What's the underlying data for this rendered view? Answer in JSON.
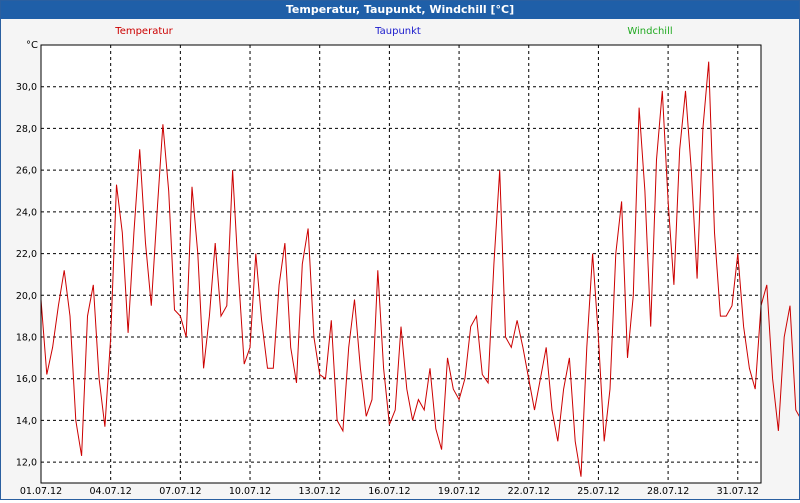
{
  "window": {
    "title": "Temperatur, Taupunkt, Windchill [°C]"
  },
  "colors": {
    "temperatur": "#cc0000",
    "taupunkt": "#1a1acc",
    "windchill": "#22aa22",
    "titlebar": "#1f5fa8",
    "grid": "#000000"
  },
  "chart_data": {
    "type": "line",
    "title": "Temperatur, Taupunkt, Windchill [°C]",
    "ylabel": "°C",
    "ylim": [
      11,
      32
    ],
    "yticks": [
      "12,0",
      "14,0",
      "16,0",
      "18,0",
      "20,0",
      "22,0",
      "24,0",
      "26,0",
      "28,0",
      "30,0"
    ],
    "xticks": [
      "01.07.12",
      "04.07.12",
      "07.07.12",
      "10.07.12",
      "13.07.12",
      "16.07.12",
      "19.07.12",
      "22.07.12",
      "25.07.12",
      "28.07.12",
      "31.07.12"
    ],
    "x_start": "01.07.12",
    "x_end": "01.08.12",
    "grid": true,
    "legend": [
      "Temperatur",
      "Taupunkt",
      "Windchill"
    ],
    "series": [
      {
        "name": "Temperatur",
        "points_per_day": 4,
        "values": [
          19.8,
          16.2,
          17.5,
          19.5,
          21.2,
          19.0,
          14.0,
          12.3,
          19.0,
          20.5,
          16.0,
          13.7,
          18.0,
          25.3,
          23.0,
          18.2,
          23.0,
          27.0,
          22.5,
          19.5,
          24.0,
          28.2,
          25.0,
          19.3,
          19.0,
          18.0,
          25.2,
          22.0,
          16.5,
          19.0,
          22.5,
          19.0,
          19.5,
          26.0,
          21.0,
          16.7,
          17.5,
          22.0,
          18.8,
          16.5,
          16.5,
          20.5,
          22.5,
          17.5,
          15.8,
          21.5,
          23.2,
          18.0,
          16.2,
          16.0,
          18.8,
          14.0,
          13.5,
          17.5,
          19.8,
          16.5,
          14.2,
          15.0,
          21.2,
          16.5,
          13.8,
          14.5,
          18.5,
          15.5,
          14.0,
          15.0,
          14.5,
          16.5,
          13.6,
          12.6,
          17.0,
          15.5,
          15.0,
          16.0,
          18.5,
          19.0,
          16.2,
          15.8,
          21.5,
          26.0,
          18.0,
          17.5,
          18.8,
          17.5,
          16.0,
          14.5,
          16.0,
          17.5,
          14.5,
          13.0,
          15.5,
          17.0,
          13.0,
          11.3,
          17.5,
          22.0,
          18.0,
          13.0,
          15.5,
          22.0,
          24.5,
          17.0,
          20.0,
          29.0,
          25.0,
          18.5,
          26.5,
          29.8,
          24.5,
          20.5,
          27.0,
          29.8,
          26.0,
          20.8,
          28.0,
          31.2,
          23.0,
          19.0,
          19.0,
          19.5,
          22.0,
          18.5,
          16.5,
          15.5,
          19.5,
          20.5,
          16.0,
          13.5,
          18.0,
          19.5,
          14.5,
          14.0,
          21.0,
          19.8,
          18.4
        ]
      },
      {
        "name": "Taupunkt",
        "values": []
      },
      {
        "name": "Windchill",
        "values": []
      }
    ]
  }
}
